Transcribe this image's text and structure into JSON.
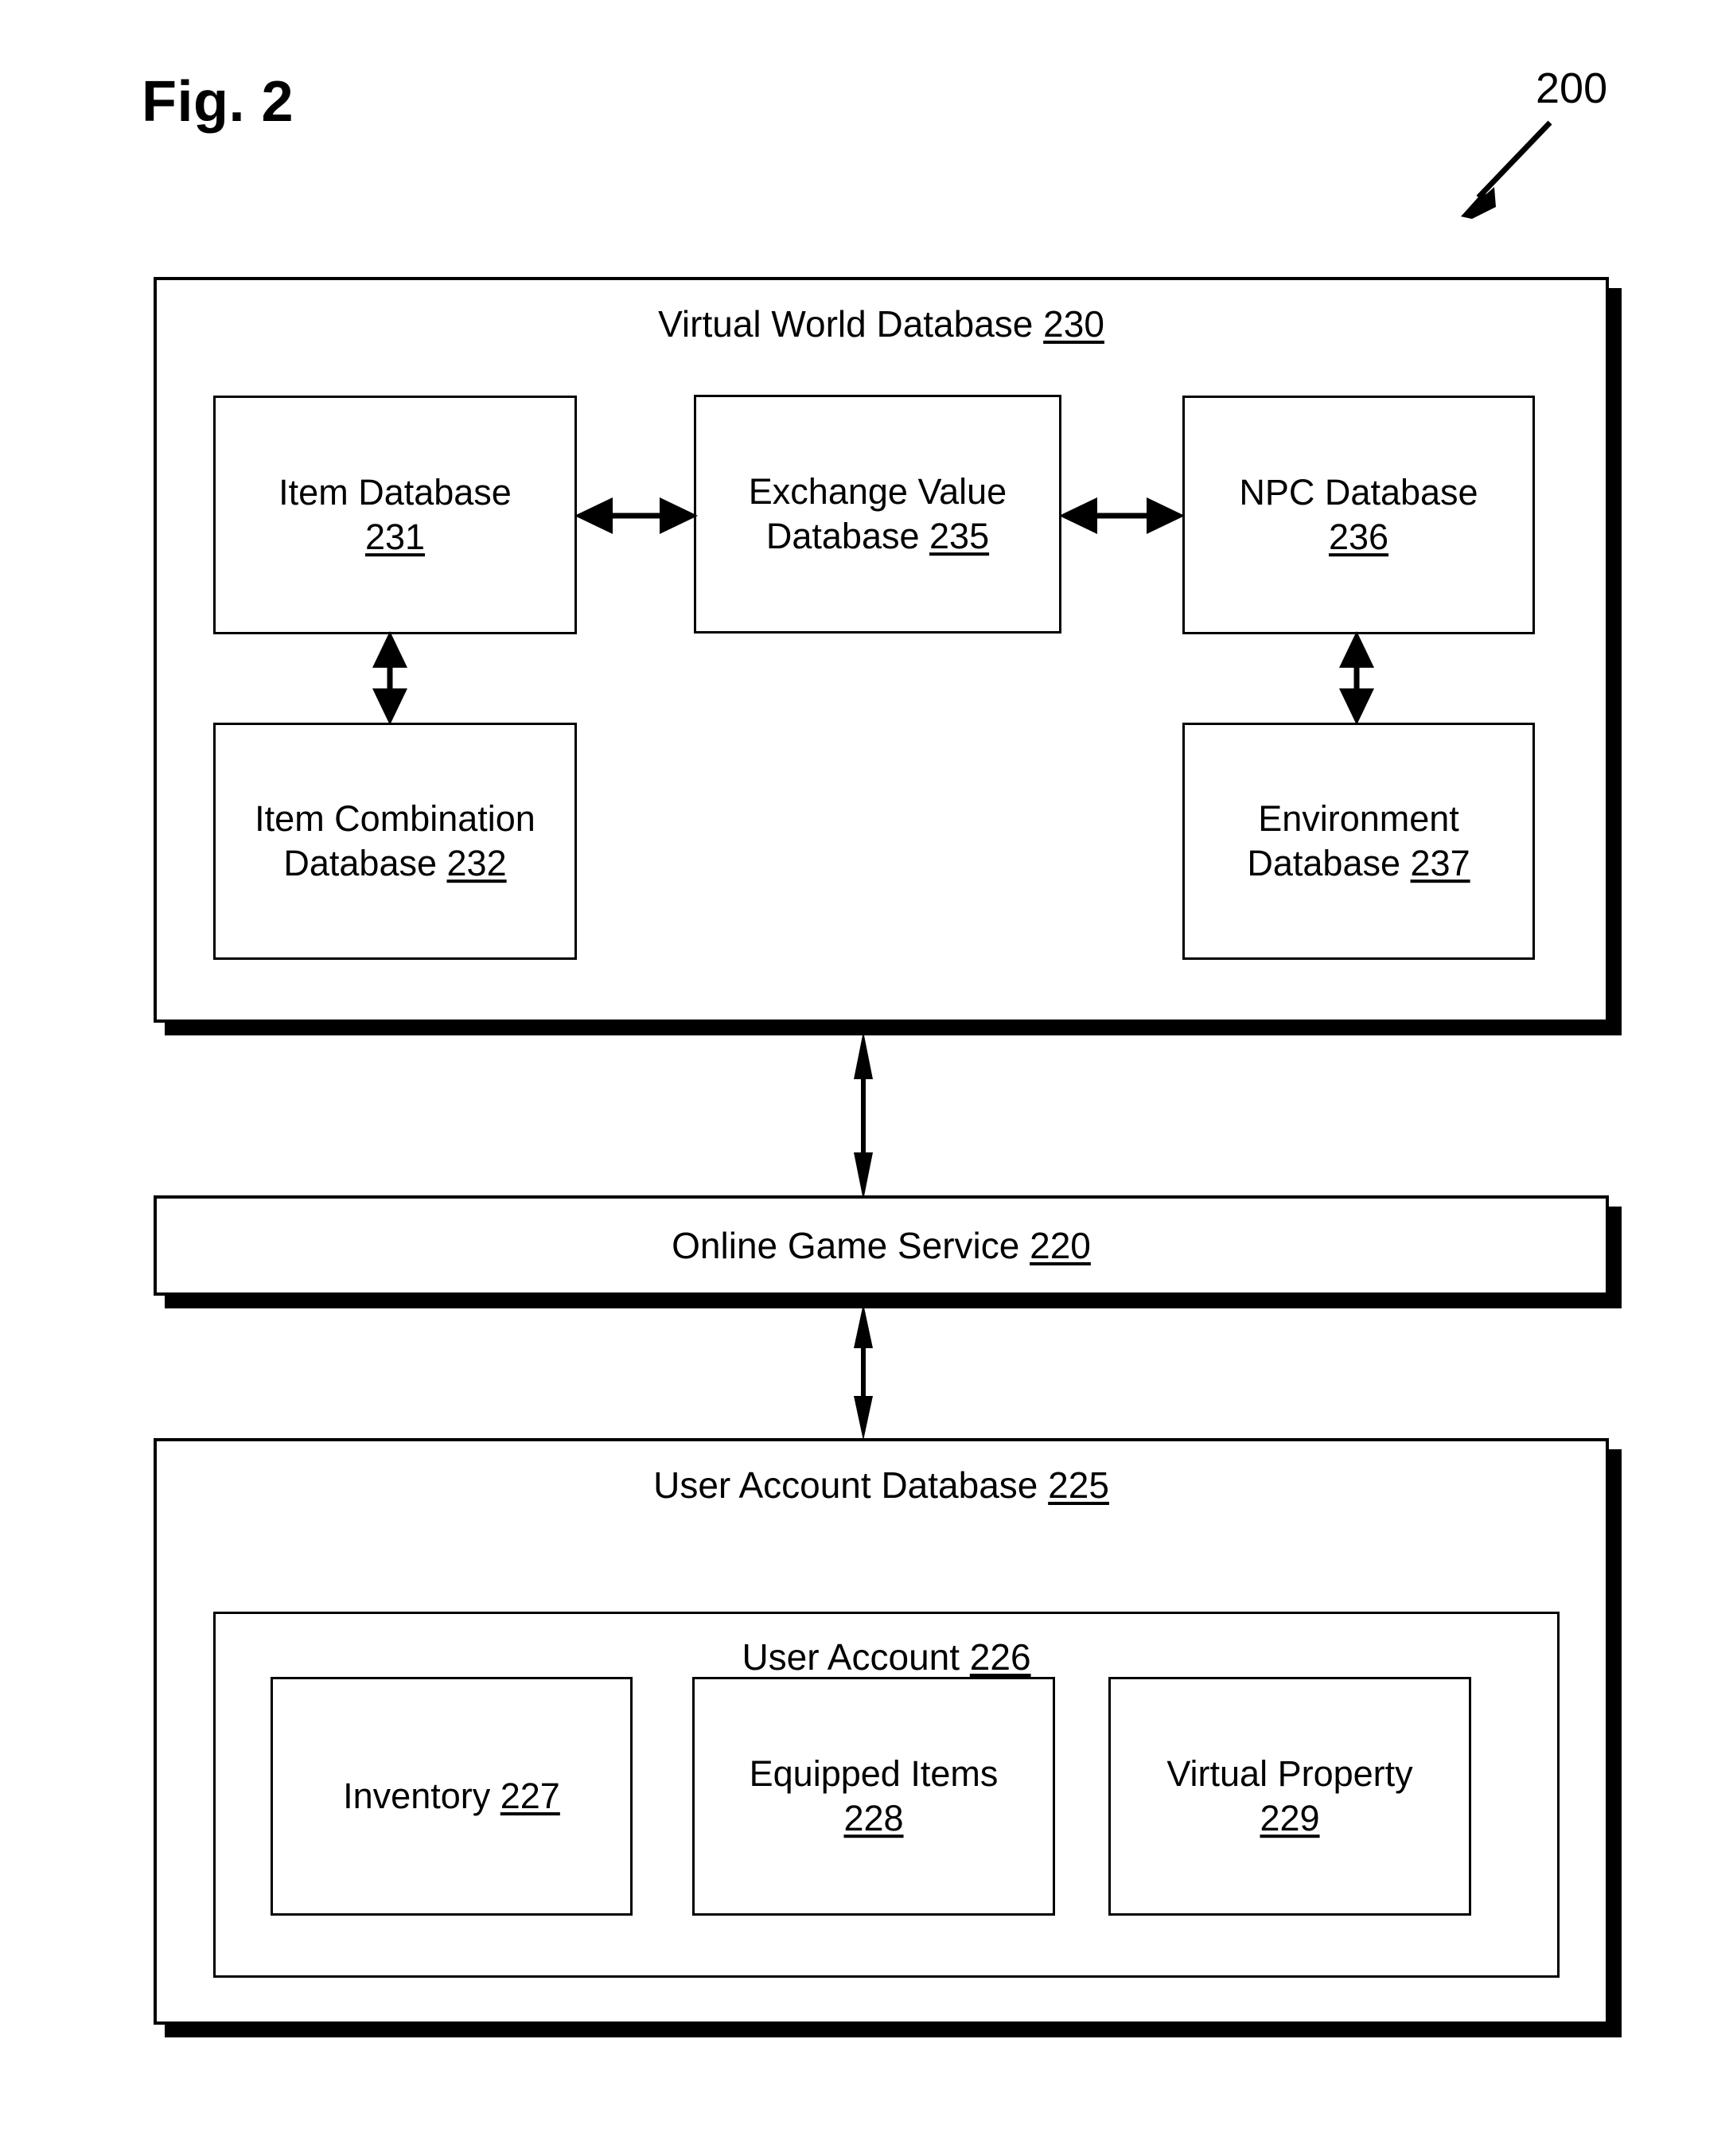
{
  "figure": {
    "title": "Fig. 2",
    "reference_numeral": "200"
  },
  "virtual_world_database": {
    "title_text": "Virtual World Database ",
    "title_number": "230",
    "children": {
      "item_database": {
        "text": "Item Database",
        "number": "231"
      },
      "exchange_value_database": {
        "text": "Exchange Value\nDatabase ",
        "number": "235"
      },
      "npc_database": {
        "text": "NPC Database",
        "number": "236"
      },
      "item_combination_database": {
        "text": "Item Combination\nDatabase ",
        "number": "232"
      },
      "environment_database": {
        "text": "Environment\nDatabase ",
        "number": "237"
      }
    }
  },
  "online_game_service": {
    "title_text": "Online Game Service ",
    "title_number": "220"
  },
  "user_account_database": {
    "title_text": "User Account Database ",
    "title_number": "225",
    "user_account": {
      "title_text": "User Account ",
      "title_number": "226",
      "children": {
        "inventory": {
          "text": "Inventory ",
          "number": "227"
        },
        "equipped_items": {
          "text": "Equipped Items",
          "number": "228"
        },
        "virtual_property": {
          "text": "Virtual Property",
          "number": "229"
        }
      }
    }
  },
  "connections": [
    {
      "name": "item-db-to-exchange-value",
      "type": "bidirectional-horizontal"
    },
    {
      "name": "exchange-value-to-npc-db",
      "type": "bidirectional-horizontal"
    },
    {
      "name": "item-db-to-item-combination",
      "type": "bidirectional-vertical"
    },
    {
      "name": "npc-db-to-environment-db",
      "type": "bidirectional-vertical"
    },
    {
      "name": "virtual-world-db-to-online-game-service",
      "type": "bidirectional-vertical"
    },
    {
      "name": "online-game-service-to-user-account-db",
      "type": "bidirectional-vertical"
    }
  ],
  "colors": {
    "stroke": "#000000",
    "background": "#ffffff"
  }
}
